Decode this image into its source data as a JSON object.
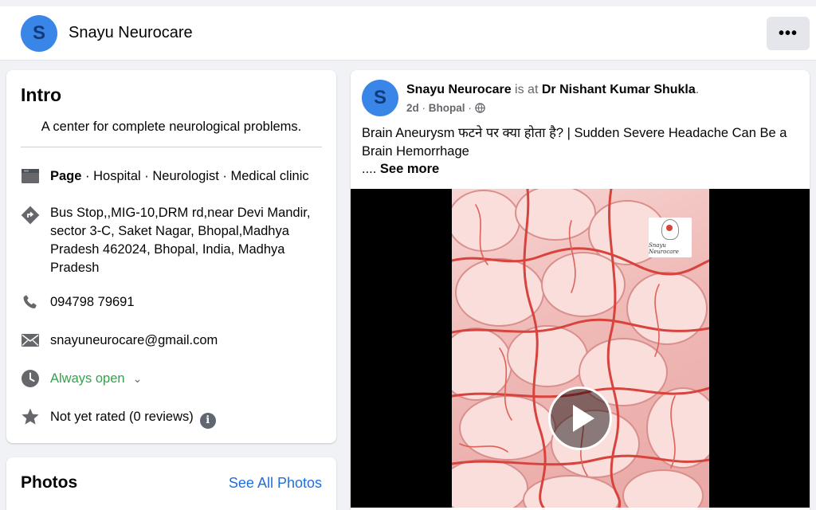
{
  "header": {
    "avatar_letter": "S",
    "page_name": "Snayu Neurocare",
    "more_label": "•••"
  },
  "intro": {
    "title": "Intro",
    "description": "A center for complete neurological problems.",
    "page_type_bold": "Page",
    "page_categories": " · Hospital · Neurologist · Medical clinic",
    "address": "Bus Stop,,MIG-10,DRM rd,near Devi Mandir, sector 3-C, Saket Nagar, Bhopal,Madhya Pradesh 462024, Bhopal, India, Madhya Pradesh",
    "phone": "094798 79691",
    "email": "snayuneurocare@gmail.com",
    "hours": "Always open",
    "rating": "Not yet rated (0 reviews)"
  },
  "photos": {
    "title": "Photos",
    "see_all": "See All Photos"
  },
  "post": {
    "avatar_letter": "S",
    "author": "Snayu Neurocare",
    "connector": " is at ",
    "location_name": "Dr Nishant Kumar Shukla",
    "location_end": ".",
    "time": "2d",
    "place": "Bhopal",
    "text": "Brain Aneurysm फटने पर क्या होता है? | Sudden Severe Headache Can Be a Brain Hemorrhage",
    "ellipsis": ".... ",
    "see_more": "See more",
    "watermark": "Snayu Neurocare"
  },
  "colors": {
    "accent_blue": "#216fdb",
    "avatar_blue": "#3a86e8",
    "status_green": "#31a24c"
  },
  "icons": [
    "page-icon",
    "directions-icon",
    "phone-icon",
    "mail-icon",
    "clock-icon",
    "star-icon",
    "info-icon",
    "globe-icon",
    "more-icon",
    "play-icon"
  ]
}
